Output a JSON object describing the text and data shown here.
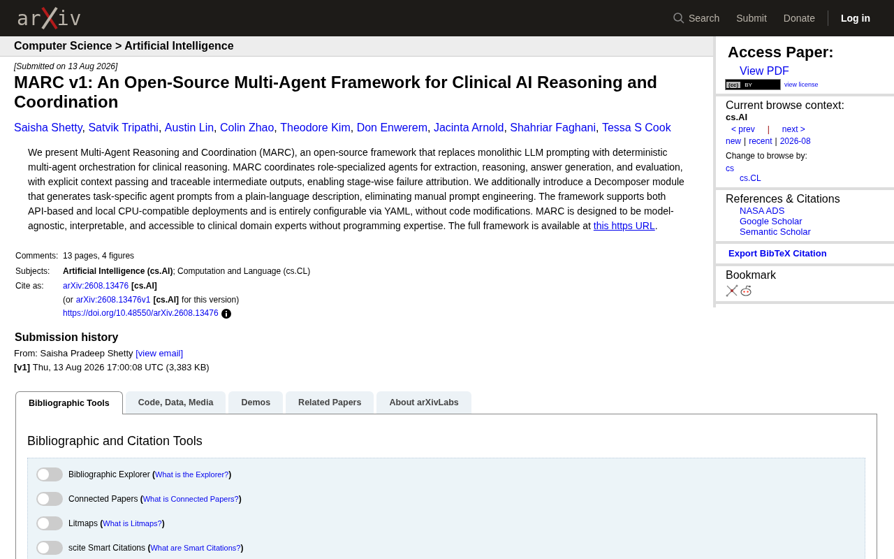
{
  "header": {
    "logo_left": "ar",
    "logo_right": "iv",
    "nav": [
      {
        "kind": "search",
        "text": "Search"
      },
      {
        "kind": "link",
        "text": "Submit"
      },
      {
        "kind": "link",
        "text": "Donate"
      },
      {
        "kind": "login",
        "text": "Log in"
      }
    ]
  },
  "breadcrumb": "Computer Science > Artificial Intelligence",
  "submitted": "[Submitted on 13 Aug 2026]",
  "title": "MARC v1: An Open-Source Multi-Agent Framework for Clinical AI Reasoning and Coordination",
  "authors": [
    "Saisha Shetty",
    "Satvik Tripathi",
    "Austin Lin",
    "Colin Zhao",
    "Theodore Kim",
    "Don Enwerem",
    "Jacinta Arnold",
    "Shahriar Faghani",
    "Tessa S Cook"
  ],
  "author_separator": ",",
  "abstract": {
    "text": "We present Multi-Agent Reasoning and Coordination (MARC), an open-source framework that replaces monolithic LLM prompting with deterministic multi-agent orchestration for clinical reasoning. MARC coordinates role-specialized agents for extraction, reasoning, answer generation, and evaluation, with explicit context passing and traceable intermediate outputs, enabling stage-wise failure attribution. We additionally introduce a Decomposer module that generates task-specific agent prompts from a plain-language description, eliminating manual prompt engineering. The framework supports both API-based and local CPU-compatible deployments and is entirely configurable via YAML, without code modifications. MARC is designed to be model-agnostic, interpretable, and accessible to clinical domain experts without programming expertise. The full framework is available at",
    "link": "this https URL",
    "end": "."
  },
  "metadata": [
    {
      "label": "Comments:",
      "lines": [
        [
          {
            "kind": "text",
            "text": "13 pages, 4 figures"
          }
        ]
      ]
    },
    {
      "label": "Subjects:",
      "lines": [
        [
          {
            "kind": "text",
            "text": "**Artificial Intelligence (cs.AI)**; Computation and Language (cs.CL)"
          }
        ]
      ]
    },
    {
      "label": "Cite as:",
      "lines": [
        [
          {
            "kind": "link",
            "text": "arXiv:2608.13476"
          },
          {
            "kind": "bold",
            "text": "[cs.AI]"
          }
        ],
        [
          {
            "kind": "text",
            "text": "(or"
          },
          {
            "kind": "link",
            "text": "arXiv:2608.13476v1"
          },
          {
            "kind": "bold",
            "text": "[cs.AI]"
          },
          {
            "kind": "text",
            "text": "for this version)"
          }
        ],
        [
          {
            "kind": "link",
            "text": "https://doi.org/10.48550/arXiv.2608.13476"
          },
          {
            "kind": "info"
          }
        ]
      ]
    }
  ],
  "history": {
    "heading": "Submission history",
    "from_label": "From: Saisha Pradeep Shetty",
    "email_link": "[view email]",
    "version": "[v1]",
    "version_text": "Thu, 13 Aug 2026 17:00:08 UTC (3,383 KB)"
  },
  "tabs": [
    {
      "label": "Bibliographic Tools",
      "selected": true
    },
    {
      "label": "Code, Data, Media",
      "selected": false
    },
    {
      "label": "Demos",
      "selected": false
    },
    {
      "label": "Related Papers",
      "selected": false
    },
    {
      "label": "About arXivLabs",
      "selected": false
    }
  ],
  "tools": {
    "heading": "Bibliographic and Citation Tools",
    "open": "(",
    "close": ")",
    "items": [
      {
        "name": "Bibliographic Explorer",
        "link": "What is the Explorer?",
        "on": false
      },
      {
        "name": "Connected Papers",
        "link": "What is Connected Papers?",
        "on": false
      },
      {
        "name": "Litmaps",
        "link": "What is Litmaps?",
        "on": false
      },
      {
        "name": "scite Smart Citations",
        "link": "What are Smart Citations?",
        "on": false
      }
    ]
  },
  "sidebar": {
    "access_heading": "Access Paper:",
    "view_pdf": "View PDF",
    "license_cc": "(cc)",
    "license_badge": "BY",
    "license_link": "view license",
    "context_heading": "Current browse context:",
    "context": "cs.AI",
    "nav1": [
      {
        "kind": "link",
        "text": "< prev"
      },
      {
        "kind": "sep",
        "text": "|"
      },
      {
        "kind": "link",
        "text": "next >"
      }
    ],
    "nav2": [
      {
        "kind": "link",
        "text": "new"
      },
      {
        "kind": "sep",
        "text": "|"
      },
      {
        "kind": "link",
        "text": "recent"
      },
      {
        "kind": "sep",
        "text": "|"
      },
      {
        "kind": "link",
        "text": "2026-08"
      }
    ],
    "change_label": "Change to browse by:",
    "browse": [
      {
        "text": "cs",
        "children": [
          {
            "text": "cs.CL"
          }
        ]
      }
    ],
    "refs_heading": "References & Citations",
    "refs": [
      "NASA ADS",
      "Google Scholar",
      "Semantic Scholar"
    ],
    "export": "Export BibTeX Citation",
    "bookmark_heading": "Bookmark"
  }
}
